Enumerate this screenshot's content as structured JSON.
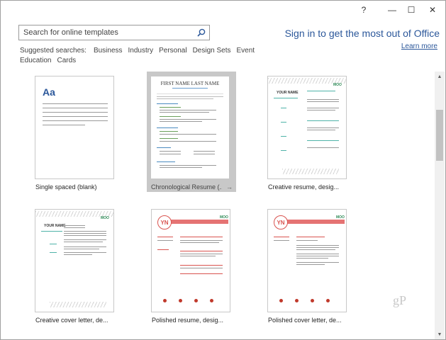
{
  "window": {
    "help": "?",
    "minimize": "—",
    "maximize": "☐",
    "close": "✕"
  },
  "search": {
    "placeholder": "Search for online templates"
  },
  "suggested": {
    "label": "Suggested searches:",
    "items": [
      "Business",
      "Industry",
      "Personal",
      "Design Sets",
      "Event",
      "Education",
      "Cards"
    ]
  },
  "account": {
    "signin": "Sign in to get the most out of Office",
    "learn_more": "Learn more"
  },
  "templates": [
    {
      "label": "Single spaced (blank)",
      "thumb_text": "Aa"
    },
    {
      "label": "Chronological Resume (...",
      "thumb_text": "FIRST NAME LAST NAME"
    },
    {
      "label": "Creative resume, desig...",
      "thumb_text": "YOUR NAME"
    },
    {
      "label": "Creative cover letter, de...",
      "thumb_text": "YOUR NAME"
    },
    {
      "label": "Polished resume, desig...",
      "thumb_text": "YN"
    },
    {
      "label": "Polished cover letter, de...",
      "thumb_text": "YN"
    }
  ],
  "watermark": "gP",
  "colors": {
    "accent": "#2b579a",
    "selected": "#c8c8c8",
    "polished_red": "#e57373"
  }
}
